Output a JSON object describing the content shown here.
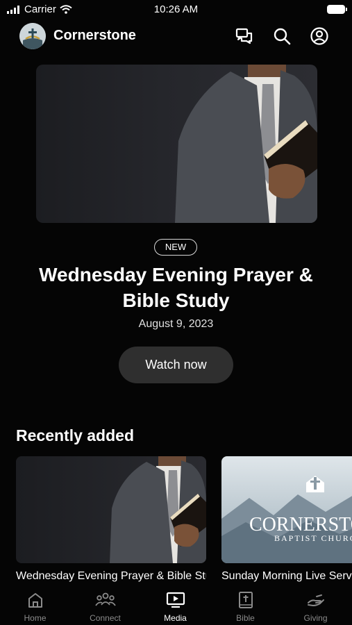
{
  "status_bar": {
    "carrier": "Carrier",
    "time": "10:26 AM"
  },
  "header": {
    "title": "Cornerstone",
    "icons": [
      "chat-icon",
      "search-icon",
      "profile-icon"
    ]
  },
  "hero": {
    "badge": "NEW",
    "title": "Wednesday Evening Prayer & Bible Study",
    "date": "August 9, 2023",
    "button_label": "Watch now"
  },
  "recently_added": {
    "title": "Recently added",
    "items": [
      {
        "title": "Wednesday Evening Prayer & Bible Study"
      },
      {
        "title": "Sunday Morning Live Service",
        "thumb_text_main": "CORNERSTONE",
        "thumb_text_sub": "BAPTIST CHURCH"
      }
    ]
  },
  "tabs": [
    {
      "label": "Home",
      "icon": "home-icon"
    },
    {
      "label": "Connect",
      "icon": "people-icon"
    },
    {
      "label": "Media",
      "icon": "media-icon",
      "active": true
    },
    {
      "label": "Bible",
      "icon": "bible-icon"
    },
    {
      "label": "Giving",
      "icon": "giving-icon"
    }
  ],
  "colors": {
    "background": "#050505",
    "button": "#2f2f2f",
    "inactive_tab": "#8b8b8b"
  }
}
